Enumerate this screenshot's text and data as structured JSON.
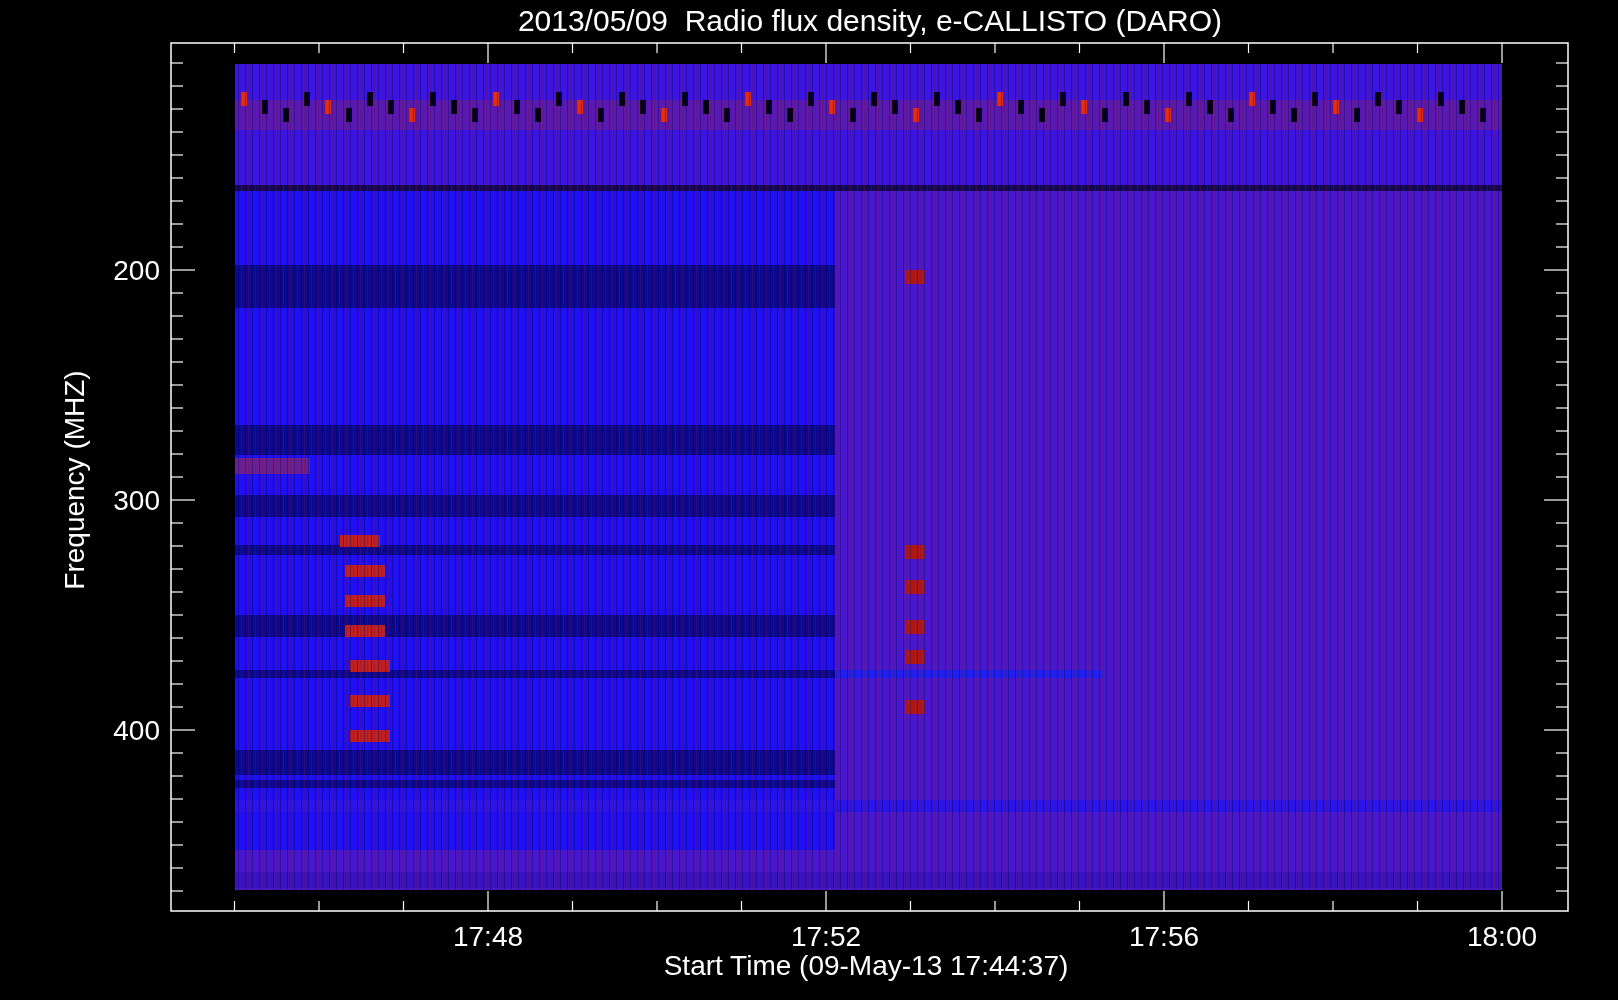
{
  "plot": {
    "title": "2013/05/09  Radio flux density, e-CALLISTO (DARO)",
    "xlabel": "Start Time (09-May-13 17:44:37)",
    "ylabel": "Frequency (MHZ)",
    "x_tick_labels": [
      "17:48",
      "17:52",
      "17:56",
      "18:00"
    ],
    "y_tick_labels": [
      "200",
      "300",
      "400"
    ]
  }
}
